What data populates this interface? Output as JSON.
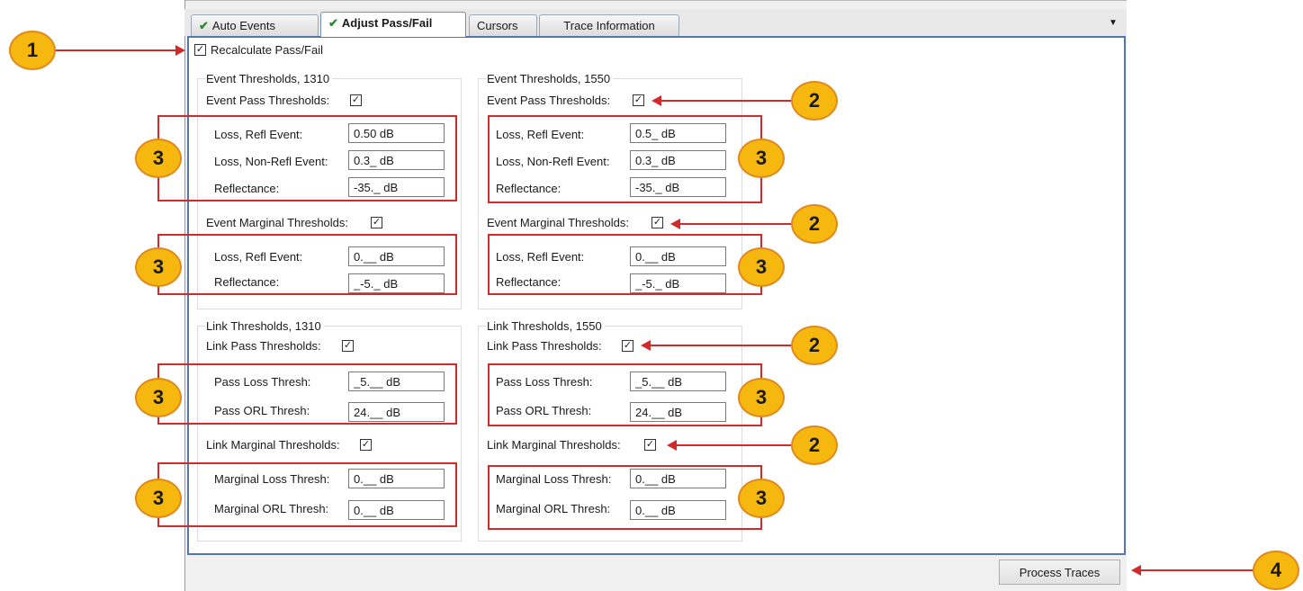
{
  "tabs": [
    {
      "label": "Auto Events",
      "checked": true
    },
    {
      "label": "Adjust Pass/Fail",
      "checked": true,
      "active": true
    },
    {
      "label": "Cursors",
      "checked": false
    },
    {
      "label": "Trace Information",
      "checked": false
    }
  ],
  "recalculate": {
    "label": "Recalculate Pass/Fail",
    "checked": true
  },
  "event_1310": {
    "title": "Event Thresholds, 1310",
    "pass_label": "Event Pass Thresholds:",
    "loss_refl_label": "Loss, Refl Event:",
    "loss_refl_value": "0.50 dB",
    "loss_nonrefl_label": "Loss, Non-Refl Event:",
    "loss_nonrefl_value": "0.3_ dB",
    "reflectance_label": "Reflectance:",
    "reflectance_value": "-35._ dB",
    "marginal_label": "Event Marginal Thresholds:",
    "m_loss_refl_label": "Loss, Refl Event:",
    "m_loss_refl_value": "0.__ dB",
    "m_reflectance_label": "Reflectance:",
    "m_reflectance_value": "_-5._ dB"
  },
  "event_1550": {
    "title": "Event Thresholds, 1550",
    "pass_label": "Event Pass Thresholds:",
    "loss_refl_label": "Loss, Refl Event:",
    "loss_refl_value": "0.5_ dB",
    "loss_nonrefl_label": "Loss, Non-Refl Event:",
    "loss_nonrefl_value": "0.3_ dB",
    "reflectance_label": "Reflectance:",
    "reflectance_value": "-35._ dB",
    "marginal_label": "Event Marginal Thresholds:",
    "m_loss_refl_label": "Loss, Refl Event:",
    "m_loss_refl_value": "0.__ dB",
    "m_reflectance_label": "Reflectance:",
    "m_reflectance_value": "_-5._ dB"
  },
  "link_1310": {
    "title": "Link Thresholds, 1310",
    "pass_label": "Link Pass Thresholds:",
    "pass_loss_label": "Pass Loss Thresh:",
    "pass_loss_value": "_5.__ dB",
    "pass_orl_label": "Pass ORL Thresh:",
    "pass_orl_value": "24.__ dB",
    "marginal_label": "Link Marginal Thresholds:",
    "marg_loss_label": "Marginal Loss Thresh:",
    "marg_loss_value": "0.__ dB",
    "marg_orl_label": "Marginal ORL Thresh:",
    "marg_orl_value": "0.__ dB"
  },
  "link_1550": {
    "title": "Link Thresholds, 1550",
    "pass_label": "Link Pass Thresholds:",
    "pass_loss_label": "Pass Loss Thresh:",
    "pass_loss_value": "_5.__ dB",
    "pass_orl_label": "Pass ORL Thresh:",
    "pass_orl_value": "24.__ dB",
    "marginal_label": "Link Marginal Thresholds:",
    "marg_loss_label": "Marginal Loss Thresh:",
    "marg_loss_value": "0.__ dB",
    "marg_orl_label": "Marginal ORL Thresh:",
    "marg_orl_value": "0.__ dB"
  },
  "process_button": "Process Traces",
  "callouts": {
    "c1": "1",
    "c2": "2",
    "c3": "3",
    "c4": "4"
  },
  "colors": {
    "callout_fill": "#f6b70f",
    "callout_arrow": "#d12a2a",
    "panel_border": "#5577aa"
  }
}
